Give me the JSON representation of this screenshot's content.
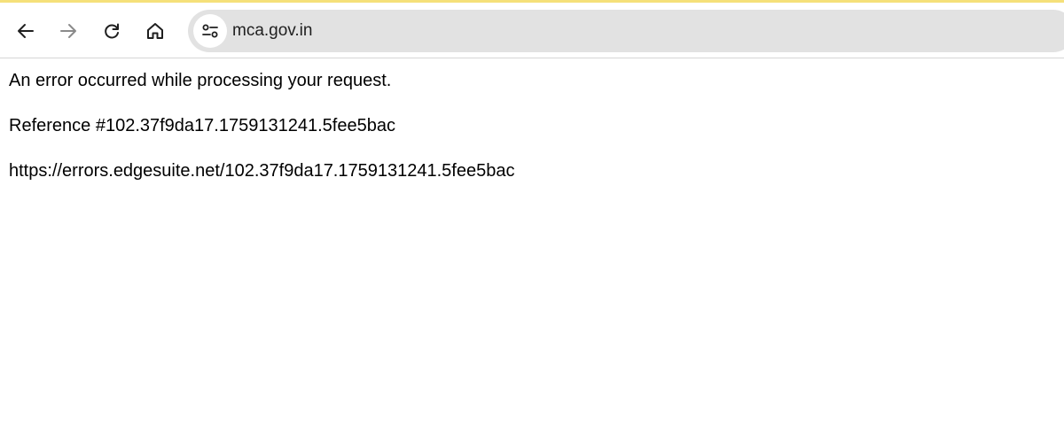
{
  "browser": {
    "url": "mca.gov.in",
    "icons": {
      "back": "back-arrow-icon",
      "forward": "forward-arrow-icon",
      "reload": "reload-icon",
      "home": "home-icon",
      "site_info": "tune-icon"
    },
    "accent_color": "#f5e07a"
  },
  "page": {
    "error_message": "An error occurred while processing your request.",
    "reference": "Reference #102.37f9da17.1759131241.5fee5bac",
    "link": "https://errors.edgesuite.net/102.37f9da17.1759131241.5fee5bac"
  }
}
